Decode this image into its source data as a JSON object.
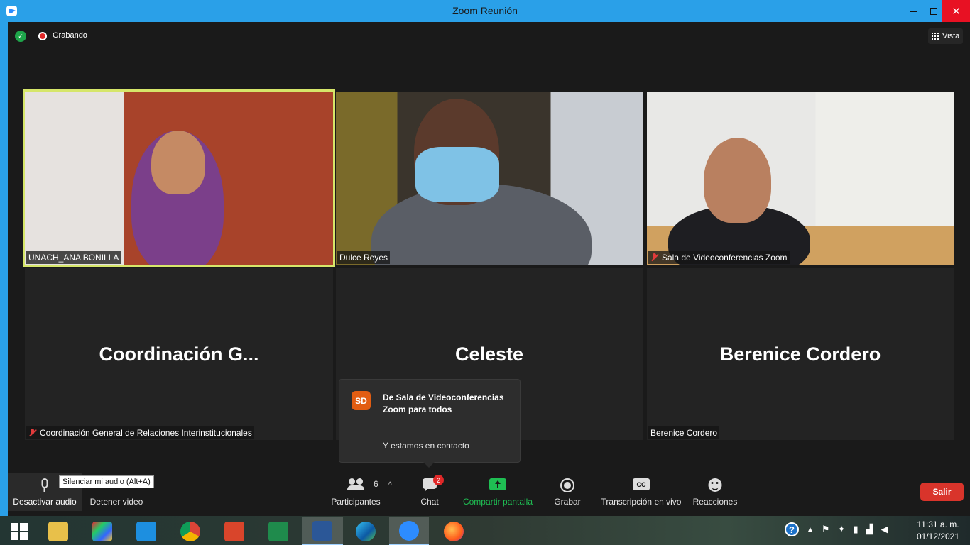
{
  "window": {
    "title": "Zoom Reunión",
    "minimize_symbol": "",
    "close_symbol": "✕"
  },
  "topbar": {
    "recording_label": "Grabando",
    "view_label": "Vista"
  },
  "participants": [
    {
      "name": "UNACH_ANA BONILLA",
      "muted": false,
      "video": true,
      "active_speaker": true
    },
    {
      "name": "Dulce Reyes",
      "muted": false,
      "video": true,
      "active_speaker": false
    },
    {
      "name": "Sala de Videoconferencias Zoom",
      "muted": true,
      "video": true,
      "active_speaker": false
    },
    {
      "display_name": "Coordinación  G...",
      "name": "Coordinación General de Relaciones Interinstitucionales",
      "muted": true,
      "video": false
    },
    {
      "display_name": "Celeste",
      "name": "",
      "muted": false,
      "video": false
    },
    {
      "display_name": "Berenice Cordero",
      "name": "Berenice Cordero",
      "muted": false,
      "video": false
    }
  ],
  "chat_popup": {
    "avatar_initials": "SD",
    "from": "De Sala de Videoconferencias Zoom para todos",
    "message": "Y estamos en contacto"
  },
  "toolbar": {
    "tooltip": "Silenciar mi audio (Alt+A)",
    "audio_label": "Desactivar audio",
    "video_label": "Detener video",
    "participants_label": "Participantes",
    "participants_count": "6",
    "caret": "^",
    "chat_label": "Chat",
    "chat_badge": "2",
    "share_label": "Compartir pantalla",
    "record_label": "Grabar",
    "cc_icon_text": "CC",
    "transcription_label": "Transcripción en vivo",
    "reactions_label": "Reacciones",
    "exit_label": "Salir"
  },
  "taskbar": {
    "apps": [
      "start",
      "file-explorer",
      "app-colorful",
      "touch-app",
      "chrome",
      "office-red",
      "excel",
      "word",
      "edge",
      "zoom",
      "firefox"
    ],
    "active_apps": [
      "word",
      "zoom"
    ],
    "clock_time": "11:31 a. m.",
    "clock_date": "01/12/2021"
  },
  "colors": {
    "titlebar": "#2aa0e8",
    "active_speaker_border": "#d6e66a",
    "share_green": "#1fbe53",
    "exit_red": "#d9342b",
    "chat_avatar": "#e25d12",
    "badge_red": "#e02828"
  }
}
